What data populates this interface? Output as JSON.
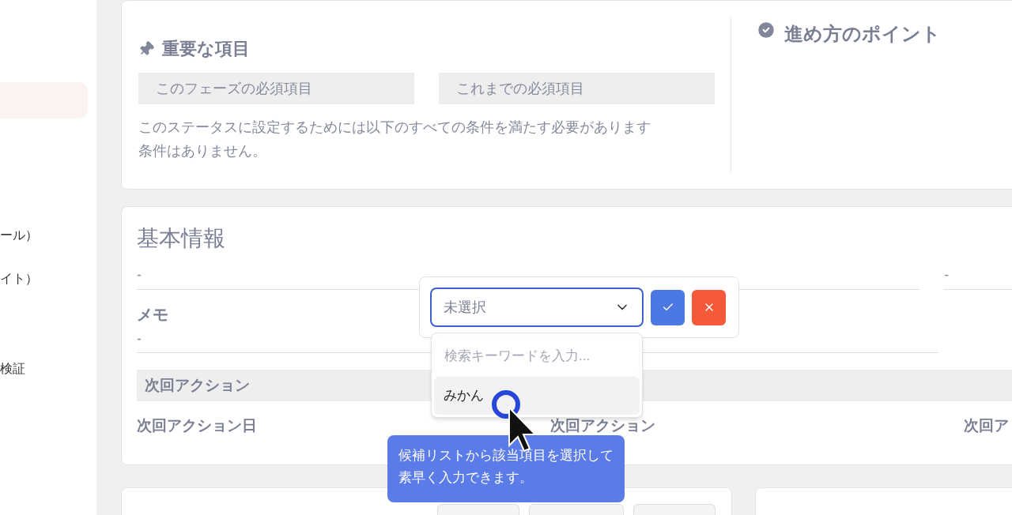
{
  "sidebar": {
    "items": [
      {
        "label": "ール）"
      },
      {
        "label": "イト）"
      },
      {
        "label": "検証"
      }
    ]
  },
  "important": {
    "title": "重要な項目",
    "tabs": [
      "このフェーズの必須項目",
      "これまでの必須項目"
    ],
    "description": "このステータスに設定するためには以下のすべての条件を満たす必要があります",
    "empty": "条件はありません。"
  },
  "tips": {
    "title": "進め方のポイント"
  },
  "basic_info": {
    "title": "基本情報",
    "fields": [
      {
        "value": "-"
      },
      {
        "value": "-"
      }
    ],
    "memo": {
      "label": "メモ",
      "value": "-"
    },
    "section": "次回アクション",
    "labels": [
      "次回アクション日",
      "次回アクション",
      "次回ア"
    ]
  },
  "editor": {
    "select": {
      "value": "未選択"
    },
    "search": {
      "placeholder": "検索キーワードを入力..."
    },
    "options": [
      {
        "label": "みかん",
        "hovered": true
      }
    ]
  },
  "tooltip": "候補リストから該当項目を選択して素早く入力できます。"
}
